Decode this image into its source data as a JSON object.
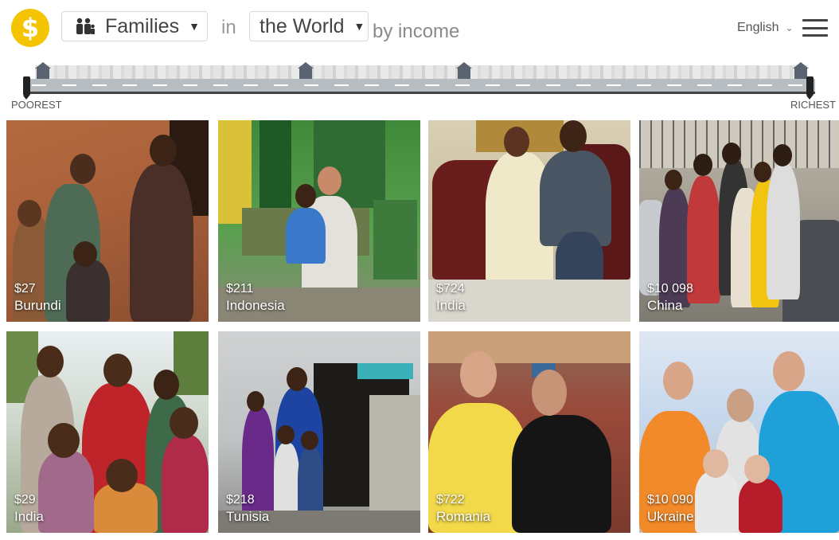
{
  "header": {
    "logo_symbol": "$",
    "families_label": "Families",
    "in_word": "in",
    "world_label": "the World",
    "by_income": "by income",
    "language": "English",
    "icons": {
      "logo": "dollar-coin-icon",
      "families": "people-icon",
      "caret": "caret-down-icon",
      "lang_chevron": "chevron-down-icon",
      "menu": "hamburger-menu-icon"
    }
  },
  "street": {
    "left_label": "POOREST",
    "right_label": "RICHEST"
  },
  "families": [
    {
      "price": "$27",
      "country": "Burundi"
    },
    {
      "price": "$211",
      "country": "Indonesia"
    },
    {
      "price": "$724",
      "country": "India"
    },
    {
      "price": "$10 098",
      "country": "China"
    },
    {
      "price": "$29",
      "country": "India"
    },
    {
      "price": "$218",
      "country": "Tunisia"
    },
    {
      "price": "$722",
      "country": "Romania"
    },
    {
      "price": "$10 090",
      "country": "Ukraine"
    }
  ],
  "colors": {
    "logo": "#f5c400",
    "road": "#b8bdc2",
    "house": "#5a6470"
  }
}
